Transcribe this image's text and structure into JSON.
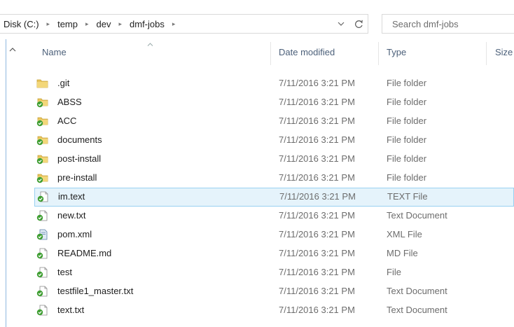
{
  "address": {
    "crumbs": [
      "Disk (C:)",
      "temp",
      "dev",
      "dmf-jobs"
    ],
    "separator": "▸",
    "dropdown_icon": "chevron-down-icon",
    "refresh_icon": "refresh-icon"
  },
  "search": {
    "placeholder": "Search dmf-jobs"
  },
  "columns": {
    "name": "Name",
    "date": "Date modified",
    "type": "Type",
    "size": "Size"
  },
  "rows": [
    {
      "name": ".git",
      "date": "7/11/2016 3:21 PM",
      "type": "File folder",
      "icon": "folder-icon"
    },
    {
      "name": "ABSS",
      "date": "7/11/2016 3:21 PM",
      "type": "File folder",
      "icon": "folder-synced-icon"
    },
    {
      "name": "ACC",
      "date": "7/11/2016 3:21 PM",
      "type": "File folder",
      "icon": "folder-synced-icon"
    },
    {
      "name": "documents",
      "date": "7/11/2016 3:21 PM",
      "type": "File folder",
      "icon": "folder-synced-icon"
    },
    {
      "name": "post-install",
      "date": "7/11/2016 3:21 PM",
      "type": "File folder",
      "icon": "folder-synced-icon"
    },
    {
      "name": "pre-install",
      "date": "7/11/2016 3:21 PM",
      "type": "File folder",
      "icon": "folder-synced-icon"
    },
    {
      "name": "im.text",
      "date": "7/11/2016 3:21 PM",
      "type": "TEXT File",
      "icon": "file-synced-icon",
      "selected": true
    },
    {
      "name": "new.txt",
      "date": "7/11/2016 3:21 PM",
      "type": "Text Document",
      "icon": "file-synced-icon"
    },
    {
      "name": "pom.xml",
      "date": "7/11/2016 3:21 PM",
      "type": "XML File",
      "icon": "xml-file-synced-icon"
    },
    {
      "name": "README.md",
      "date": "7/11/2016 3:21 PM",
      "type": "MD File",
      "icon": "file-synced-icon"
    },
    {
      "name": "test",
      "date": "7/11/2016 3:21 PM",
      "type": "File",
      "icon": "file-synced-icon"
    },
    {
      "name": "testfile1_master.txt",
      "date": "7/11/2016 3:21 PM",
      "type": "Text Document",
      "icon": "file-synced-icon"
    },
    {
      "name": "text.txt",
      "date": "7/11/2016 3:21 PM",
      "type": "Text Document",
      "icon": "file-synced-icon"
    }
  ],
  "colors": {
    "selection_bg": "#e5f3fb",
    "selection_border": "#99d1f2",
    "header_text": "#4c607a",
    "sync_green": "#3f9e32",
    "folder_yellow": "#e8c45b"
  }
}
